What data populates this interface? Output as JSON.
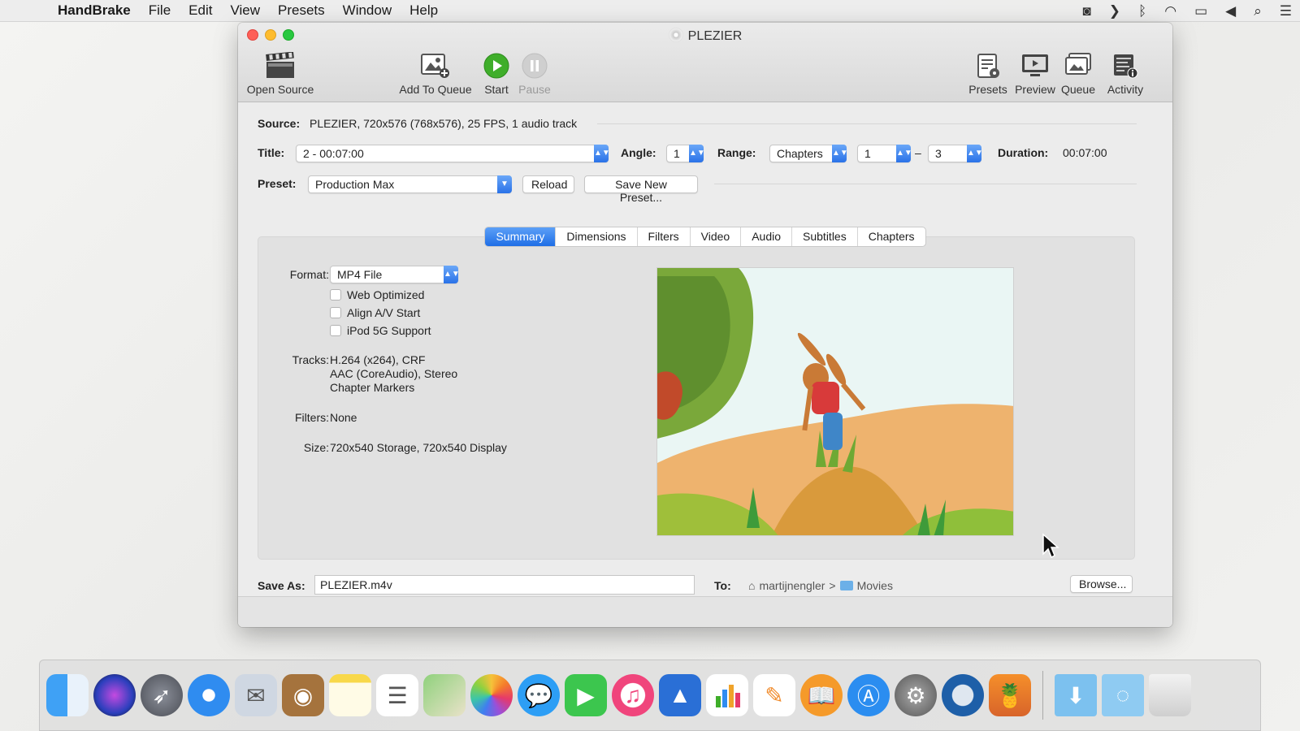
{
  "menubar": {
    "app_name": "HandBrake",
    "items": [
      "File",
      "Edit",
      "View",
      "Presets",
      "Window",
      "Help"
    ]
  },
  "window": {
    "title": "PLEZIER",
    "toolbar": {
      "open_source": "Open Source",
      "add_to_queue": "Add To Queue",
      "start": "Start",
      "pause": "Pause",
      "presets": "Presets",
      "preview": "Preview",
      "queue": "Queue",
      "activity": "Activity"
    }
  },
  "source": {
    "label": "Source:",
    "value": "PLEZIER, 720x576 (768x576), 25 FPS, 1 audio track"
  },
  "title_row": {
    "title_label": "Title:",
    "title_value": "2 - 00:07:00",
    "angle_label": "Angle:",
    "angle_value": "1",
    "range_label": "Range:",
    "range_value": "Chapters",
    "range_from": "1",
    "range_dash": "–",
    "range_to": "3",
    "duration_label": "Duration:",
    "duration_value": "00:07:00"
  },
  "preset_row": {
    "label": "Preset:",
    "value": "Production Max",
    "reload": "Reload",
    "save_new": "Save New Preset..."
  },
  "tabs": [
    "Summary",
    "Dimensions",
    "Filters",
    "Video",
    "Audio",
    "Subtitles",
    "Chapters"
  ],
  "summary": {
    "format_label": "Format:",
    "format_value": "MP4 File",
    "checkboxes": [
      "Web Optimized",
      "Align A/V Start",
      "iPod 5G Support"
    ],
    "tracks_label": "Tracks:",
    "tracks": [
      "H.264 (x264), CRF",
      "AAC (CoreAudio), Stereo",
      "Chapter Markers"
    ],
    "filters_label": "Filters:",
    "filters_value": "None",
    "size_label": "Size:",
    "size_value": "720x540 Storage, 720x540 Display"
  },
  "save": {
    "label": "Save As:",
    "value": "PLEZIER.m4v",
    "to_label": "To:",
    "path_user": "martijnengler",
    "path_sep": ">",
    "path_folder": "Movies",
    "browse": "Browse..."
  },
  "dock": {
    "icons": [
      "finder-icon",
      "siri-icon",
      "launchpad-icon",
      "safari-icon",
      "mail-icon",
      "contacts-icon",
      "notes-icon",
      "reminders-icon",
      "maps-icon",
      "photos-icon",
      "messages-icon",
      "facetime-icon",
      "itunes-icon",
      "keynote-icon",
      "numbers-icon",
      "pages-icon",
      "ibooks-icon",
      "app-store-icon",
      "system-preferences-icon",
      "quicktime-icon",
      "handbrake-icon",
      "downloads-folder-icon",
      "documents-folder-icon",
      "trash-icon"
    ]
  },
  "colors": {
    "accent": "#2a72e8",
    "start_green": "#3fae2a"
  }
}
